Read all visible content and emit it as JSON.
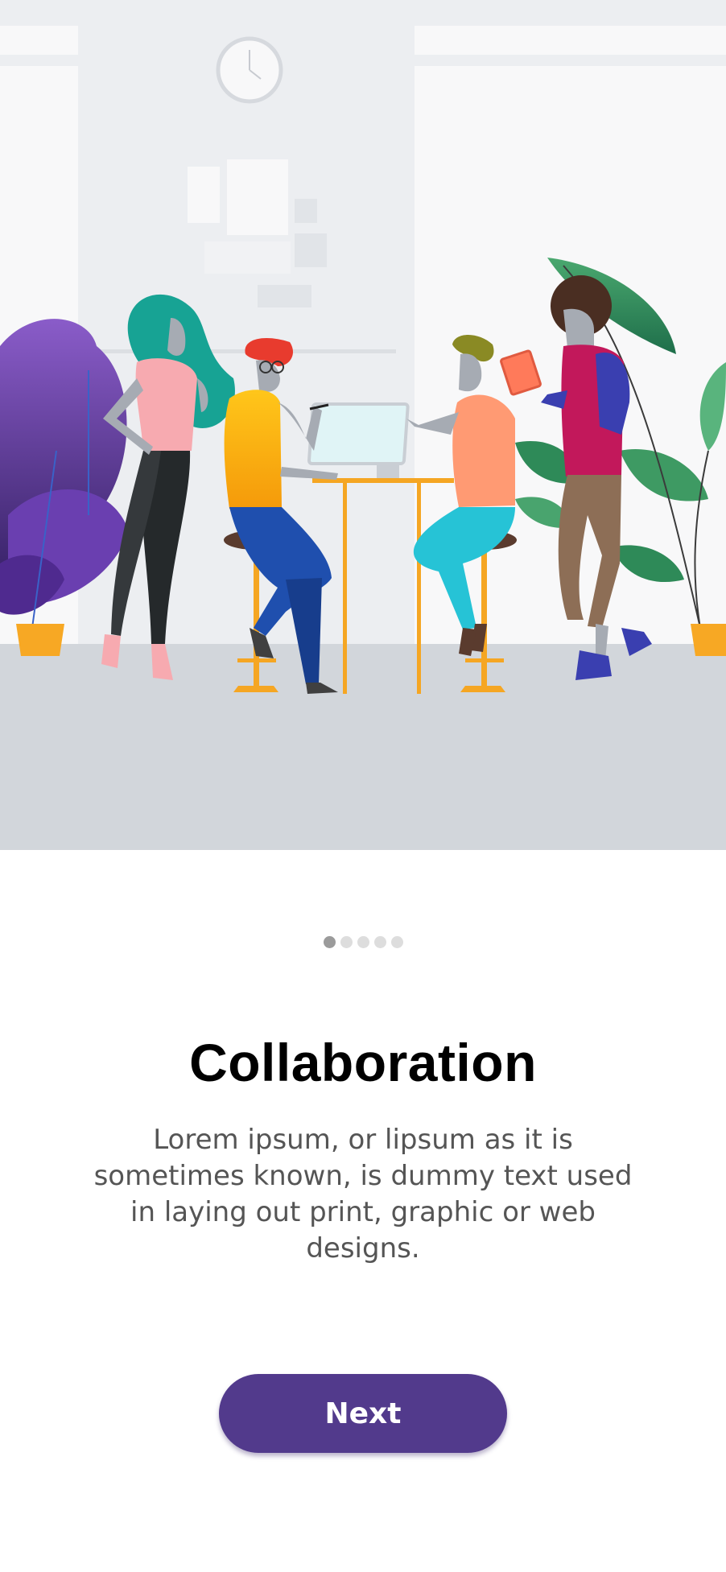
{
  "onboarding": {
    "title": "Collaboration",
    "description": "Lorem ipsum, or lipsum as it is sometimes known, is dummy text used in laying out print, graphic or web designs.",
    "next_label": "Next",
    "page_count": 5,
    "current_page": 1
  },
  "colors": {
    "accent": "#523a8c",
    "dot_active": "#9b9b9b",
    "dot_inactive": "#dddddd",
    "illustration_wall": "#eceef1",
    "illustration_floor": "#d2d6db"
  },
  "illustration": {
    "subject": "team-collaboration-illustration"
  }
}
